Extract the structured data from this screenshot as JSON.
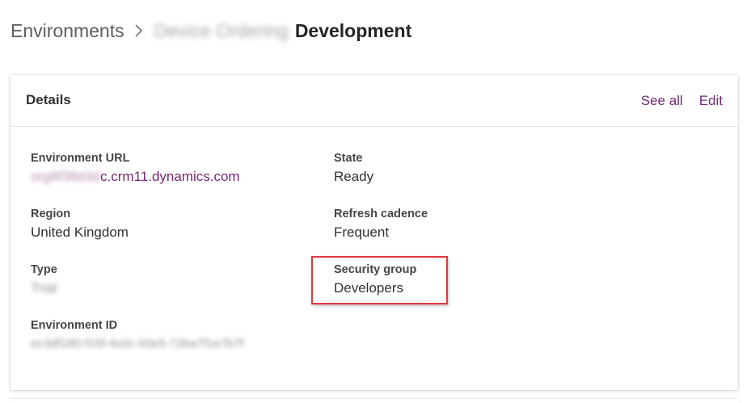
{
  "breadcrumb": {
    "root": "Environments",
    "separator_icon": "chevron-right-icon",
    "redacted_name": "Device Ordering",
    "current": "Development"
  },
  "details": {
    "title": "Details",
    "see_all": "See all",
    "edit": "Edit",
    "fields": {
      "environment_url": {
        "label": "Environment URL",
        "value_prefix_redacted": "org6f38d3d",
        "value_visible": "c.crm11.dynamics.com"
      },
      "state": {
        "label": "State",
        "value": "Ready"
      },
      "region": {
        "label": "Region",
        "value": "United Kingdom"
      },
      "refresh_cadence": {
        "label": "Refresh cadence",
        "value": "Frequent"
      },
      "type": {
        "label": "Type",
        "value_redacted": "Trial"
      },
      "security_group": {
        "label": "Security group",
        "value": "Developers"
      },
      "environment_id": {
        "label": "Environment ID",
        "value_redacted": "ec3df180-f15f-4c0c-93e5-72ba7f1e7b7f"
      }
    }
  },
  "colors": {
    "link": "#742774",
    "highlight": "#e0373e",
    "text": "#323130"
  }
}
